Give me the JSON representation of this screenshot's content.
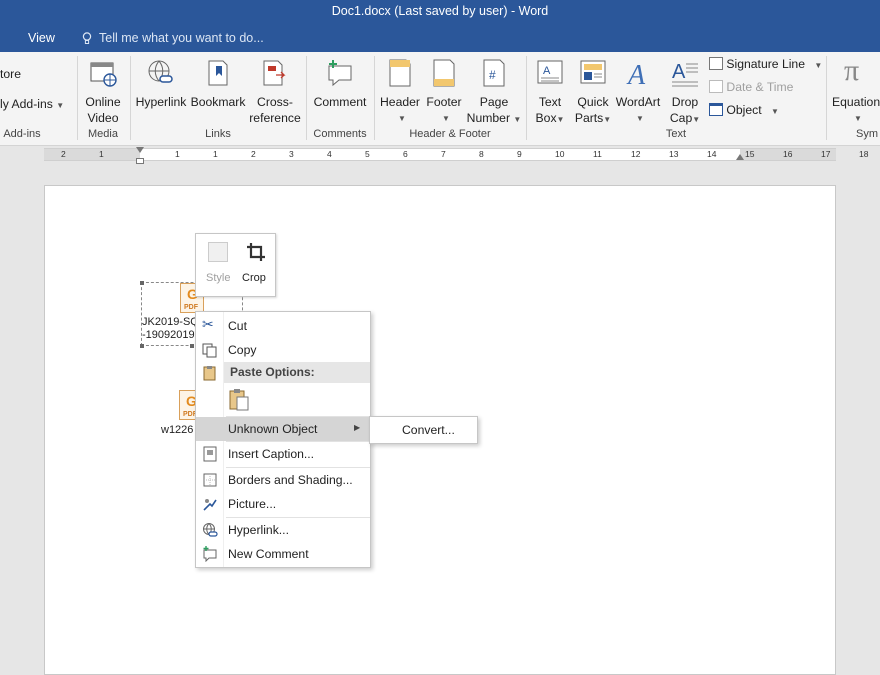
{
  "title_bar": {
    "text": "Doc1.docx (Last saved by user) - Word"
  },
  "tabs": {
    "view": "View",
    "tell_me": "Tell me what you want to do..."
  },
  "ribbon": {
    "addins_group": {
      "store": "tore",
      "my_addins": "ly Add-ins",
      "label": "Add-ins"
    },
    "media_group": {
      "online_video_1": "Online",
      "online_video_2": "Video",
      "label": "Media"
    },
    "links_group": {
      "hyperlink": "Hyperlink",
      "bookmark": "Bookmark",
      "cross_ref_1": "Cross-",
      "cross_ref_2": "reference",
      "label": "Links"
    },
    "comments_group": {
      "comment": "Comment",
      "label": "Comments"
    },
    "header_footer_group": {
      "header": "Header",
      "footer": "Footer",
      "page_number_1": "Page",
      "page_number_2": "Number",
      "label": "Header & Footer"
    },
    "text_group": {
      "text_box_1": "Text",
      "text_box_2": "Box",
      "quick_parts_1": "Quick",
      "quick_parts_2": "Parts",
      "wordart": "WordArt",
      "drop_cap_1": "Drop",
      "drop_cap_2": "Cap",
      "signature_line": "Signature Line",
      "date_time": "Date & Time",
      "object": "Object",
      "label": "Text"
    },
    "symbols_group": {
      "equation": "Equation",
      "label": "Sym"
    }
  },
  "ruler": {
    "ticks": [
      "2",
      "1",
      "1",
      "1",
      "2",
      "3",
      "4",
      "5",
      "6",
      "7",
      "8",
      "9",
      "10",
      "11",
      "12",
      "13",
      "14",
      "15",
      "16",
      "17",
      "18"
    ]
  },
  "document": {
    "object1_name_1": "JK2019-SQ",
    "object1_name_2": "-19092019-",
    "object2_name": "w1226",
    "pdf_badge": "PDF"
  },
  "mini_toolbar": {
    "style": "Style",
    "crop": "Crop"
  },
  "context_menu": {
    "cut": "Cut",
    "copy": "Copy",
    "paste_options": "Paste Options:",
    "unknown_object": "Unknown Object",
    "insert_caption": "Insert Caption...",
    "borders_shading": "Borders and Shading...",
    "picture": "Picture...",
    "hyperlink": "Hyperlink...",
    "new_comment": "New Comment"
  },
  "submenu": {
    "convert": "Convert..."
  },
  "colors": {
    "title_bar": "#2b579a",
    "menu_highlight": "#d5d5d5",
    "accent_icon": "#2b579a"
  }
}
